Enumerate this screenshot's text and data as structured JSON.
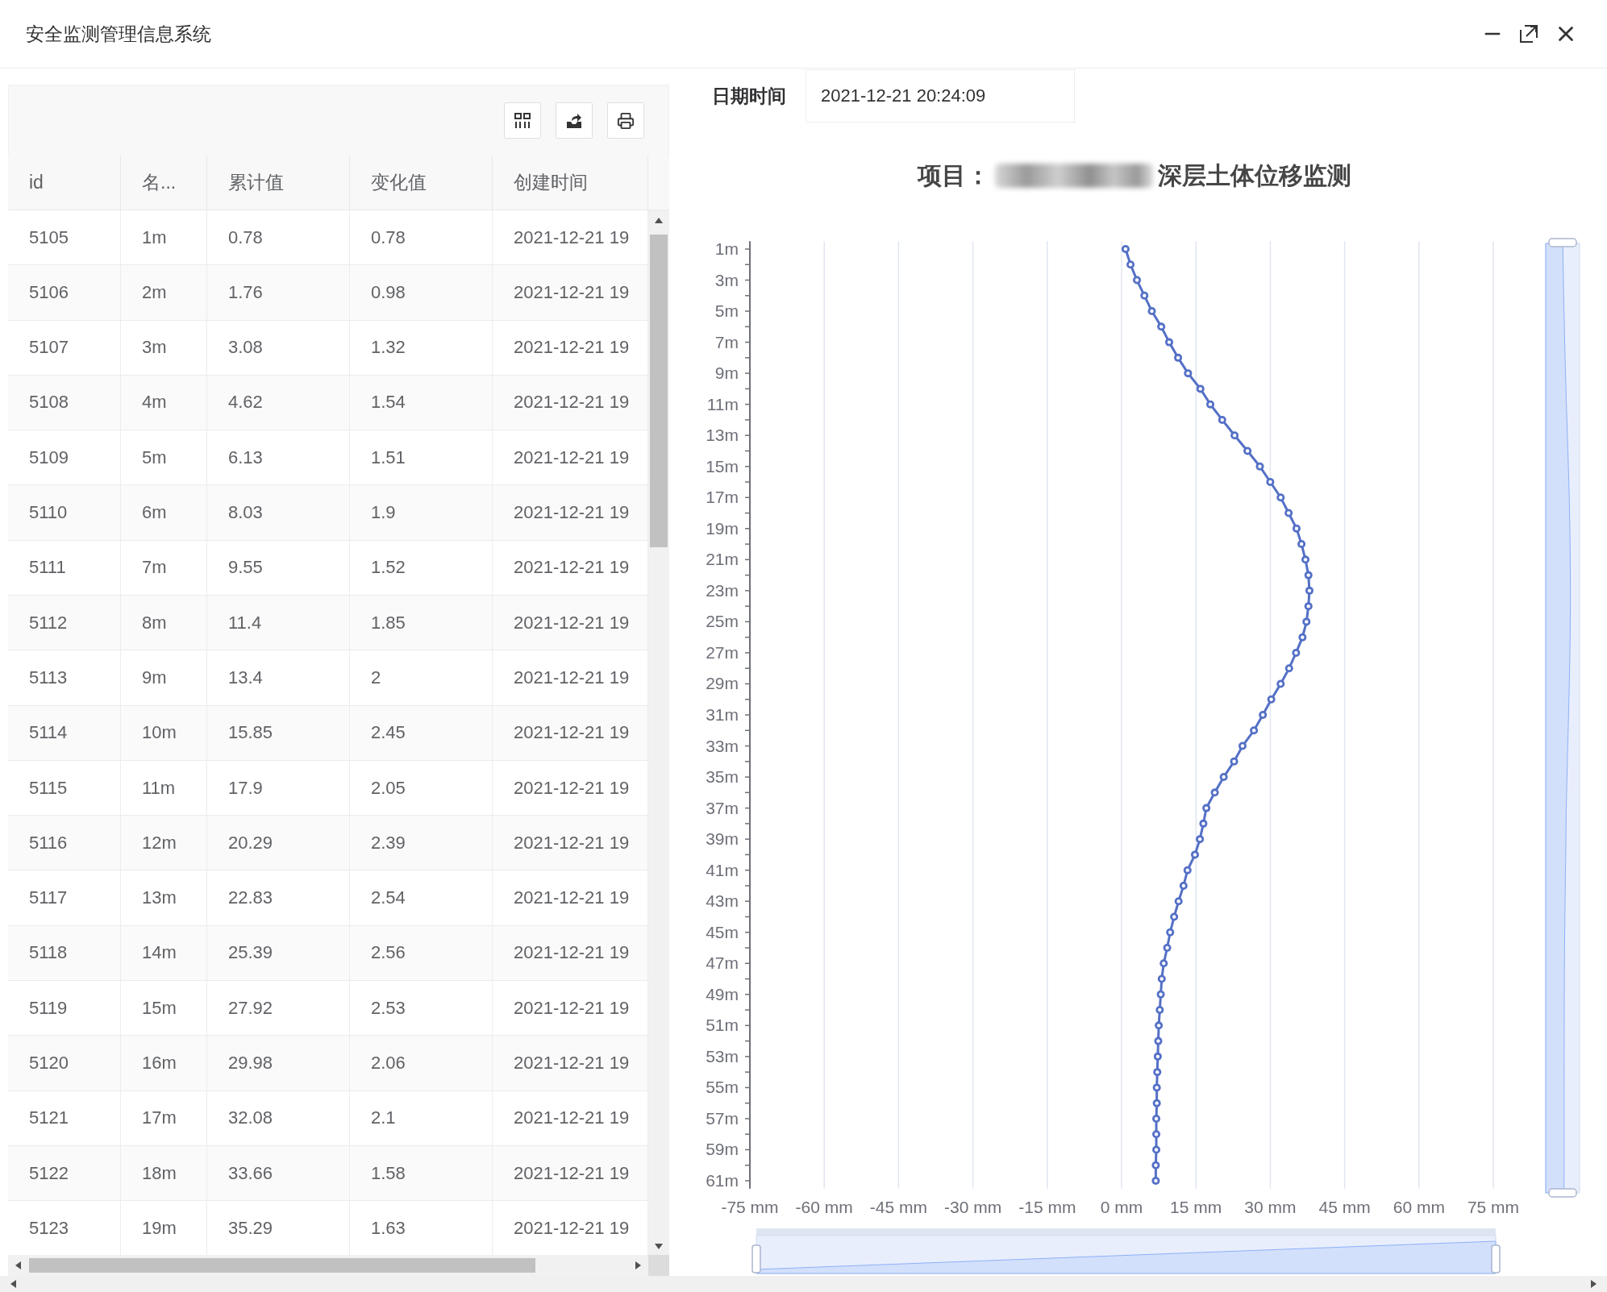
{
  "window": {
    "title": "安全监测管理信息系统"
  },
  "table": {
    "columns": [
      "id",
      "名...",
      "累计值",
      "变化值",
      "创建时间"
    ],
    "rows": [
      [
        "5105",
        "1m",
        "0.78",
        "0.78",
        "2021-12-21 19"
      ],
      [
        "5106",
        "2m",
        "1.76",
        "0.98",
        "2021-12-21 19"
      ],
      [
        "5107",
        "3m",
        "3.08",
        "1.32",
        "2021-12-21 19"
      ],
      [
        "5108",
        "4m",
        "4.62",
        "1.54",
        "2021-12-21 19"
      ],
      [
        "5109",
        "5m",
        "6.13",
        "1.51",
        "2021-12-21 19"
      ],
      [
        "5110",
        "6m",
        "8.03",
        "1.9",
        "2021-12-21 19"
      ],
      [
        "5111",
        "7m",
        "9.55",
        "1.52",
        "2021-12-21 19"
      ],
      [
        "5112",
        "8m",
        "11.4",
        "1.85",
        "2021-12-21 19"
      ],
      [
        "5113",
        "9m",
        "13.4",
        "2",
        "2021-12-21 19"
      ],
      [
        "5114",
        "10m",
        "15.85",
        "2.45",
        "2021-12-21 19"
      ],
      [
        "5115",
        "11m",
        "17.9",
        "2.05",
        "2021-12-21 19"
      ],
      [
        "5116",
        "12m",
        "20.29",
        "2.39",
        "2021-12-21 19"
      ],
      [
        "5117",
        "13m",
        "22.83",
        "2.54",
        "2021-12-21 19"
      ],
      [
        "5118",
        "14m",
        "25.39",
        "2.56",
        "2021-12-21 19"
      ],
      [
        "5119",
        "15m",
        "27.92",
        "2.53",
        "2021-12-21 19"
      ],
      [
        "5120",
        "16m",
        "29.98",
        "2.06",
        "2021-12-21 19"
      ],
      [
        "5121",
        "17m",
        "32.08",
        "2.1",
        "2021-12-21 19"
      ],
      [
        "5122",
        "18m",
        "33.66",
        "1.58",
        "2021-12-21 19"
      ],
      [
        "5123",
        "19m",
        "35.29",
        "1.63",
        "2021-12-21 19"
      ]
    ]
  },
  "date_filter": {
    "label": "日期时间",
    "value": "2021-12-21 20:24:09"
  },
  "chart": {
    "title_label": "项目：",
    "title_text": "深层土体位移监测",
    "chart_data": {
      "type": "line",
      "orientation": "horizontal",
      "grid": true,
      "x": [
        1,
        2,
        3,
        4,
        5,
        6,
        7,
        8,
        9,
        10,
        11,
        12,
        13,
        14,
        15,
        16,
        17,
        18,
        19,
        20,
        21,
        22,
        23,
        24,
        25,
        26,
        27,
        28,
        29,
        30,
        31,
        32,
        33,
        34,
        35,
        36,
        37,
        38,
        39,
        40,
        41,
        42,
        43,
        44,
        45,
        46,
        47,
        48,
        49,
        50,
        51,
        52,
        53,
        54,
        55,
        56,
        57,
        58,
        59,
        60,
        61
      ],
      "series": [
        {
          "color": "#5470c6",
          "marker": "circle",
          "values": [
            0.8,
            1.8,
            3.1,
            4.6,
            6.1,
            8.0,
            9.6,
            11.4,
            13.4,
            15.9,
            17.9,
            20.3,
            22.8,
            25.4,
            27.9,
            30.0,
            32.1,
            33.7,
            35.3,
            36.3,
            37.1,
            37.7,
            37.9,
            37.7,
            37.3,
            36.5,
            35.2,
            33.8,
            32.1,
            30.2,
            28.5,
            26.7,
            24.4,
            22.7,
            20.6,
            18.8,
            17.1,
            16.5,
            15.8,
            14.8,
            13.3,
            12.5,
            11.5,
            10.6,
            9.8,
            9.2,
            8.5,
            8.1,
            7.9,
            7.7,
            7.5,
            7.4,
            7.3,
            7.2,
            7.1,
            7.1,
            7.0,
            7.0,
            7.0,
            6.9,
            6.9
          ]
        }
      ],
      "xlim": [
        -75,
        75
      ],
      "ylim": [
        61.5,
        0.5
      ],
      "xticks": [
        {
          "value": -75,
          "label": "-75 mm"
        },
        {
          "value": -60,
          "label": "-60 mm"
        },
        {
          "value": -45,
          "label": "-45 mm"
        },
        {
          "value": -30,
          "label": "-30 mm"
        },
        {
          "value": -15,
          "label": "-15 mm"
        },
        {
          "value": 0,
          "label": "0 mm"
        },
        {
          "value": 15,
          "label": "15 mm"
        },
        {
          "value": 30,
          "label": "30 mm"
        },
        {
          "value": 45,
          "label": "45 mm"
        },
        {
          "value": 60,
          "label": "60 mm"
        },
        {
          "value": 75,
          "label": "75 mm"
        }
      ],
      "yticks": [
        {
          "value": 1,
          "label": "1m"
        },
        {
          "value": 3,
          "label": "3m"
        },
        {
          "value": 5,
          "label": "5m"
        },
        {
          "value": 7,
          "label": "7m"
        },
        {
          "value": 9,
          "label": "9m"
        },
        {
          "value": 11,
          "label": "11m"
        },
        {
          "value": 13,
          "label": "13m"
        },
        {
          "value": 15,
          "label": "15m"
        },
        {
          "value": 17,
          "label": "17m"
        },
        {
          "value": 19,
          "label": "19m"
        },
        {
          "value": 21,
          "label": "21m"
        },
        {
          "value": 23,
          "label": "23m"
        },
        {
          "value": 25,
          "label": "25m"
        },
        {
          "value": 27,
          "label": "27m"
        },
        {
          "value": 29,
          "label": "29m"
        },
        {
          "value": 31,
          "label": "31m"
        },
        {
          "value": 33,
          "label": "33m"
        },
        {
          "value": 35,
          "label": "35m"
        },
        {
          "value": 37,
          "label": "37m"
        },
        {
          "value": 39,
          "label": "39m"
        },
        {
          "value": 41,
          "label": "41m"
        },
        {
          "value": 43,
          "label": "43m"
        },
        {
          "value": 45,
          "label": "45m"
        },
        {
          "value": 47,
          "label": "47m"
        },
        {
          "value": 49,
          "label": "49m"
        },
        {
          "value": 51,
          "label": "51m"
        },
        {
          "value": 53,
          "label": "53m"
        },
        {
          "value": 55,
          "label": "55m"
        },
        {
          "value": 57,
          "label": "57m"
        },
        {
          "value": 59,
          "label": "59m"
        },
        {
          "value": 61,
          "label": "61m"
        }
      ]
    }
  }
}
